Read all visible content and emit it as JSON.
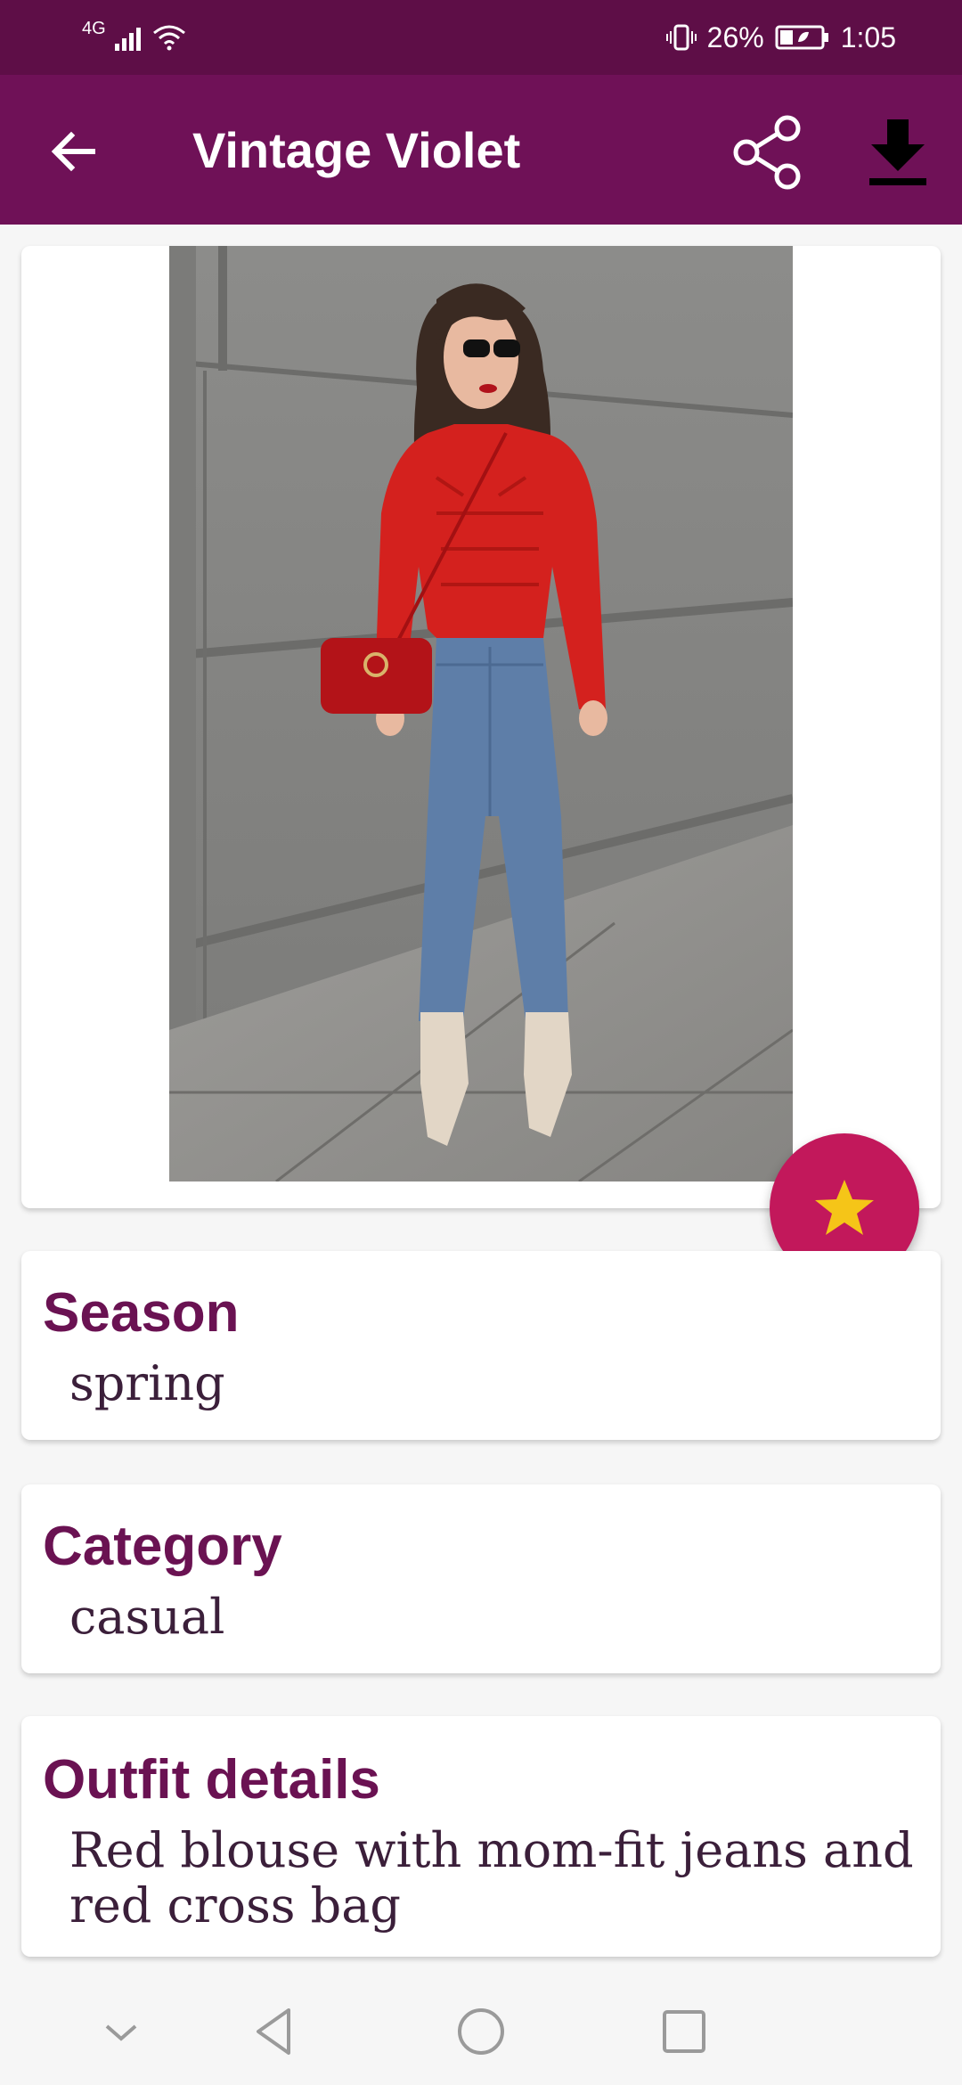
{
  "status_bar": {
    "network": "4G",
    "battery_percent": "26%",
    "time": "1:05"
  },
  "app_bar": {
    "title": "Vintage Violet",
    "back_icon": "arrow-left-icon",
    "share_icon": "share-icon",
    "download_icon": "download-icon"
  },
  "image": {
    "alt": "Woman wearing red ruffled blouse, mom-fit jeans, red crossbody bag and cream ankle boots standing against a grey wall"
  },
  "favorite_icon": "star-icon",
  "season": {
    "title": "Season",
    "value": "spring"
  },
  "category": {
    "title": "Category",
    "value": "casual"
  },
  "outfit": {
    "title": "Outfit details",
    "value": "Red blouse with mom-fit jeans and red cross bag"
  },
  "nav": {
    "items": [
      "chevron-down-icon",
      "back-triangle-icon",
      "home-circle-icon",
      "recents-square-icon"
    ]
  },
  "colors": {
    "status_bar": "#5e0e47",
    "app_bar": "#6f1157",
    "title_text": "#6a1252",
    "fab": "#c2185b",
    "star": "#f5c518"
  }
}
